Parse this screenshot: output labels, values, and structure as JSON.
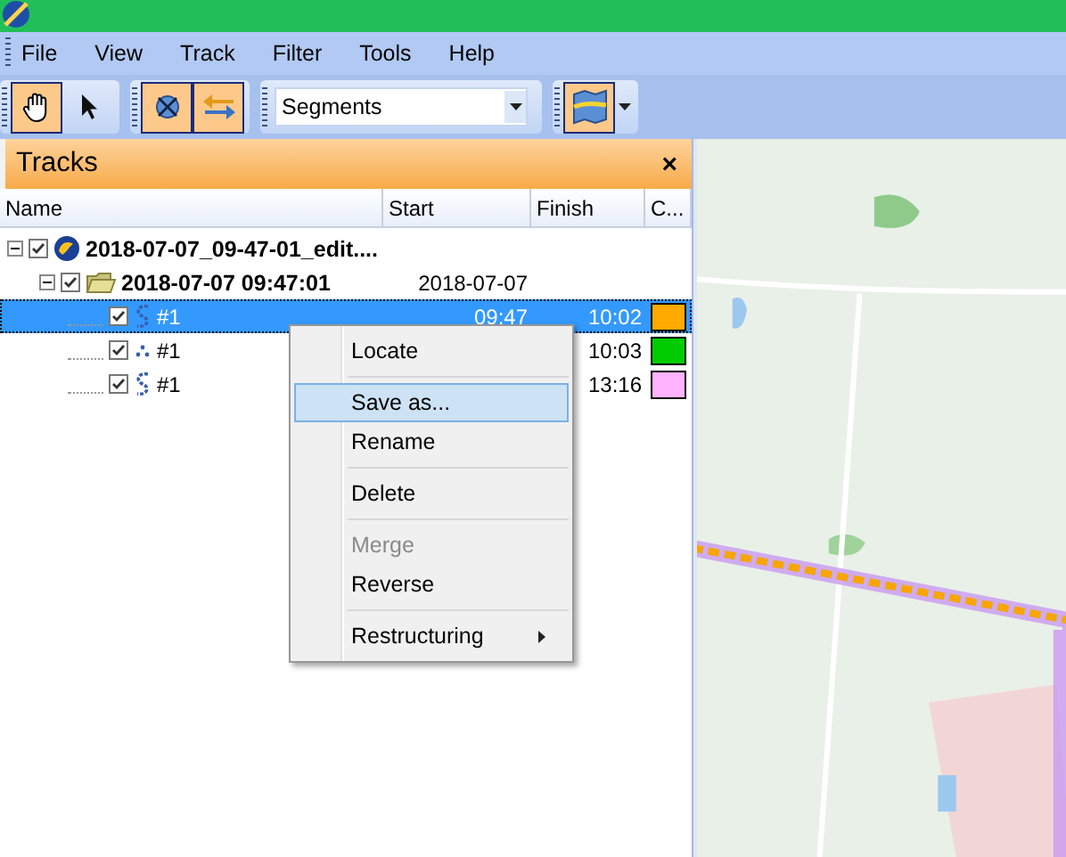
{
  "menu_bar": {
    "items": [
      "File",
      "View",
      "Track",
      "Filter",
      "Tools",
      "Help"
    ]
  },
  "toolbar": {
    "groups": [
      [
        {
          "kind": "hand",
          "selected": true
        },
        {
          "kind": "pointer",
          "selected": false
        }
      ],
      [
        {
          "kind": "cross",
          "selected": true
        },
        {
          "kind": "swap",
          "selected": true
        }
      ],
      [
        {
          "kind": "dropdown",
          "value": "Segments"
        }
      ],
      [
        {
          "kind": "map",
          "selected": true
        },
        {
          "kind": "caret",
          "selected": false
        }
      ]
    ]
  },
  "panel": {
    "title": "Tracks",
    "close": "×"
  },
  "columns": [
    "Name",
    "Start",
    "Finish",
    "C..."
  ],
  "tree": [
    {
      "name": "2018-07-07_09-47-01_edit....",
      "kind": "file",
      "checked": true,
      "expanded": true,
      "selected": false,
      "children": [
        {
          "name": "2018-07-07 09:47:01",
          "kind": "folder",
          "start": "2018-07-07",
          "checked": true,
          "expanded": true,
          "selected": false,
          "children": [
            {
              "name": "#1",
              "kind": "track",
              "start": "09:47",
              "finish": "10:02",
              "color": "#ffaa00",
              "checked": true,
              "selected": true
            },
            {
              "name": "#1",
              "kind": "points",
              "finish": "10:03",
              "color": "#00cc00",
              "checked": true,
              "selected": false
            },
            {
              "name": "#1",
              "kind": "track",
              "finish": "13:16",
              "color": "#ffb3ff",
              "checked": true,
              "selected": false
            }
          ]
        }
      ]
    }
  ],
  "context_menu": [
    {
      "kind": "item",
      "label": "Locate",
      "selected": false,
      "disabled": false
    },
    {
      "kind": "separator"
    },
    {
      "kind": "item",
      "label": "Save as...",
      "selected": true,
      "disabled": false
    },
    {
      "kind": "item",
      "label": "Rename",
      "selected": false,
      "disabled": false
    },
    {
      "kind": "separator"
    },
    {
      "kind": "item",
      "label": "Delete",
      "selected": false,
      "disabled": false
    },
    {
      "kind": "separator"
    },
    {
      "kind": "item",
      "label": "Merge",
      "selected": false,
      "disabled": true
    },
    {
      "kind": "item",
      "label": "Reverse",
      "selected": false,
      "disabled": false
    },
    {
      "kind": "separator"
    },
    {
      "kind": "submenu",
      "label": "Restructuring",
      "selected": false,
      "disabled": false
    }
  ]
}
